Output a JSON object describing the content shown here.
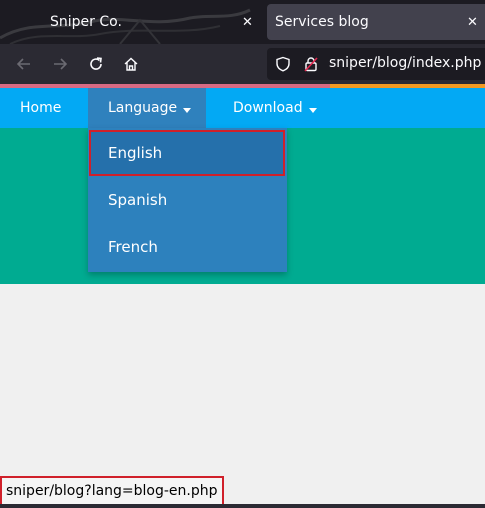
{
  "browser": {
    "tabs": [
      {
        "title": "Sniper Co.",
        "active": false
      },
      {
        "title": "Services blog",
        "active": true
      }
    ],
    "close_glyph": "✕",
    "address": "sniper/blog/index.php",
    "icons": [
      "back-arrow-icon",
      "forward-arrow-icon",
      "reload-icon",
      "home-icon",
      "shield-icon",
      "lock-icon"
    ]
  },
  "page": {
    "menu": {
      "home": "Home",
      "language": "Language",
      "download": "Download"
    },
    "language_dropdown": {
      "items": [
        "English",
        "Spanish",
        "French"
      ],
      "highlighted": "English"
    },
    "colors": {
      "menubar": "#03a9f4",
      "hero": "#00ab91",
      "dropdown": "#2d81bd",
      "highlight_border": "#d0202a"
    }
  },
  "status_bar": {
    "link_preview": "sniper/blog?lang=blog-en.php"
  }
}
